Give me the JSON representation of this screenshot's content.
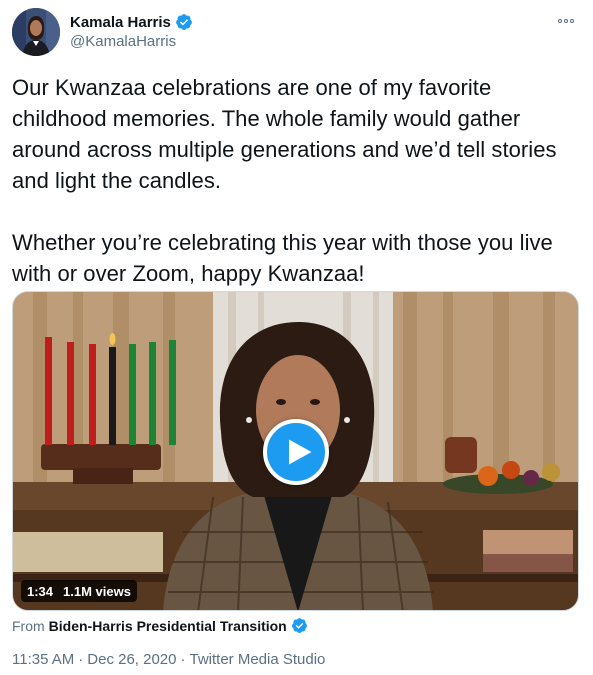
{
  "author": {
    "name": "Kamala Harris",
    "handle": "@KamalaHarris",
    "verified": true
  },
  "tweet": {
    "paragraph1": "Our Kwanzaa celebrations are one of my favorite childhood memories. The whole family would gather around across multiple generations and we’d tell stories and light the candles.",
    "paragraph2": "Whether you’re celebrating this year with those you live with or over Zoom, happy Kwanzaa!"
  },
  "video": {
    "duration": "1:34",
    "views": "1.1M views"
  },
  "source": {
    "label": "From",
    "name": "Biden-Harris Presidential Transition"
  },
  "meta": {
    "time": "11:35 AM",
    "separator": "·",
    "date": "Dec 26, 2020",
    "client": "Twitter Media Studio"
  },
  "colors": {
    "accent": "#1d9bf0",
    "secondary_text": "#5b7083",
    "primary_text": "#0f1419"
  },
  "icons": [
    "verified-badge-icon",
    "more-options-icon",
    "play-icon"
  ]
}
